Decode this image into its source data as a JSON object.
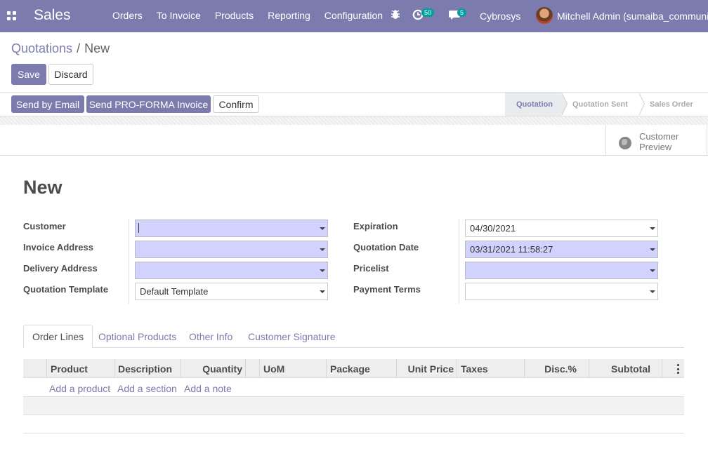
{
  "navbar": {
    "app_name": "Sales",
    "menu": [
      "Orders",
      "To Invoice",
      "Products",
      "Reporting",
      "Configuration"
    ],
    "activity_count": "50",
    "messages_count": "5",
    "company": "Cybrosys",
    "user": "Mitchell Admin (sumaiba_community)",
    "accent_color": "#7c7bad",
    "badge_color": "#00a09d"
  },
  "control_panel": {
    "breadcrumb_parent": "Quotations",
    "breadcrumb_separator": "/",
    "breadcrumb_current": "New",
    "save_label": "Save",
    "discard_label": "Discard"
  },
  "header": {
    "send_email_label": "Send by Email",
    "send_proforma_label": "Send PRO-FORMA Invoice",
    "confirm_label": "Confirm",
    "stages": [
      "Quotation",
      "Quotation Sent",
      "Sales Order"
    ],
    "active_stage": "Quotation"
  },
  "button_box": {
    "customer_preview_line1": "Customer",
    "customer_preview_line2": "Preview"
  },
  "form": {
    "title": "New",
    "left_fields": [
      {
        "label": "Customer",
        "value": ""
      },
      {
        "label": "Invoice Address",
        "value": ""
      },
      {
        "label": "Delivery Address",
        "value": ""
      },
      {
        "label": "Quotation Template",
        "value": "Default Template"
      }
    ],
    "right_fields": [
      {
        "label": "Expiration",
        "value": "04/30/2021"
      },
      {
        "label": "Quotation Date",
        "value": "03/31/2021 11:58:27"
      },
      {
        "label": "Pricelist",
        "value": ""
      },
      {
        "label": "Payment Terms",
        "value": ""
      }
    ]
  },
  "notebook": {
    "tabs": [
      "Order Lines",
      "Optional Products",
      "Other Info",
      "Customer Signature"
    ],
    "active_tab": "Order Lines"
  },
  "order_lines": {
    "columns": [
      "Product",
      "Description",
      "Quantity",
      "UoM",
      "Package",
      "Unit Price",
      "Taxes",
      "Disc.%",
      "Subtotal"
    ],
    "add_product": "Add a product",
    "add_section": "Add a section",
    "add_note": "Add a note"
  }
}
